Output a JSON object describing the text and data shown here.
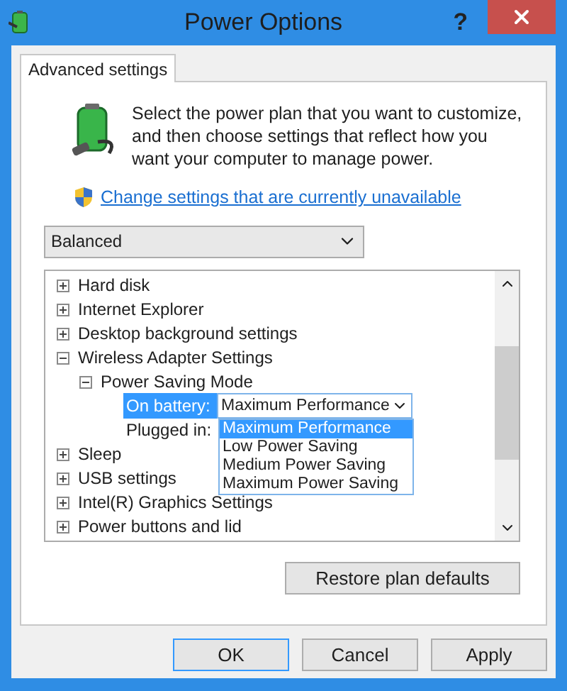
{
  "window": {
    "title": "Power Options",
    "help": "?"
  },
  "tabs": [
    {
      "label": "Advanced settings",
      "selected": true
    }
  ],
  "description": "Select the power plan that you want to customize, and then choose settings that reflect how you want your computer to manage power.",
  "link": "Change settings that are currently unavailable",
  "plan_select": {
    "value": "Balanced"
  },
  "tree": [
    {
      "kind": "group",
      "label": "Hard disk",
      "expanded": false
    },
    {
      "kind": "group",
      "label": "Internet Explorer",
      "expanded": false
    },
    {
      "kind": "group",
      "label": "Desktop background settings",
      "expanded": false
    },
    {
      "kind": "group",
      "label": "Wireless Adapter Settings",
      "expanded": true,
      "children": [
        {
          "kind": "group",
          "label": "Power Saving Mode",
          "expanded": true,
          "children": [
            {
              "kind": "setting",
              "label": "On battery:",
              "selected": true,
              "value": "Maximum Performance",
              "options": [
                {
                  "label": "Maximum Performance",
                  "selected": true
                },
                {
                  "label": "Low Power Saving",
                  "selected": false
                },
                {
                  "label": "Medium Power Saving",
                  "selected": false
                },
                {
                  "label": "Maximum Power Saving",
                  "selected": false
                }
              ]
            },
            {
              "kind": "setting",
              "label": "Plugged in:",
              "selected": false
            }
          ]
        }
      ]
    },
    {
      "kind": "group",
      "label": "Sleep",
      "expanded": false
    },
    {
      "kind": "group",
      "label": "USB settings",
      "expanded": false
    },
    {
      "kind": "group",
      "label": "Intel(R) Graphics Settings",
      "expanded": false
    },
    {
      "kind": "group",
      "label": "Power buttons and lid",
      "expanded": false
    }
  ],
  "restore_button": "Restore plan defaults",
  "buttons": [
    {
      "label": "OK",
      "default": true
    },
    {
      "label": "Cancel",
      "default": false
    },
    {
      "label": "Apply",
      "default": false
    }
  ]
}
